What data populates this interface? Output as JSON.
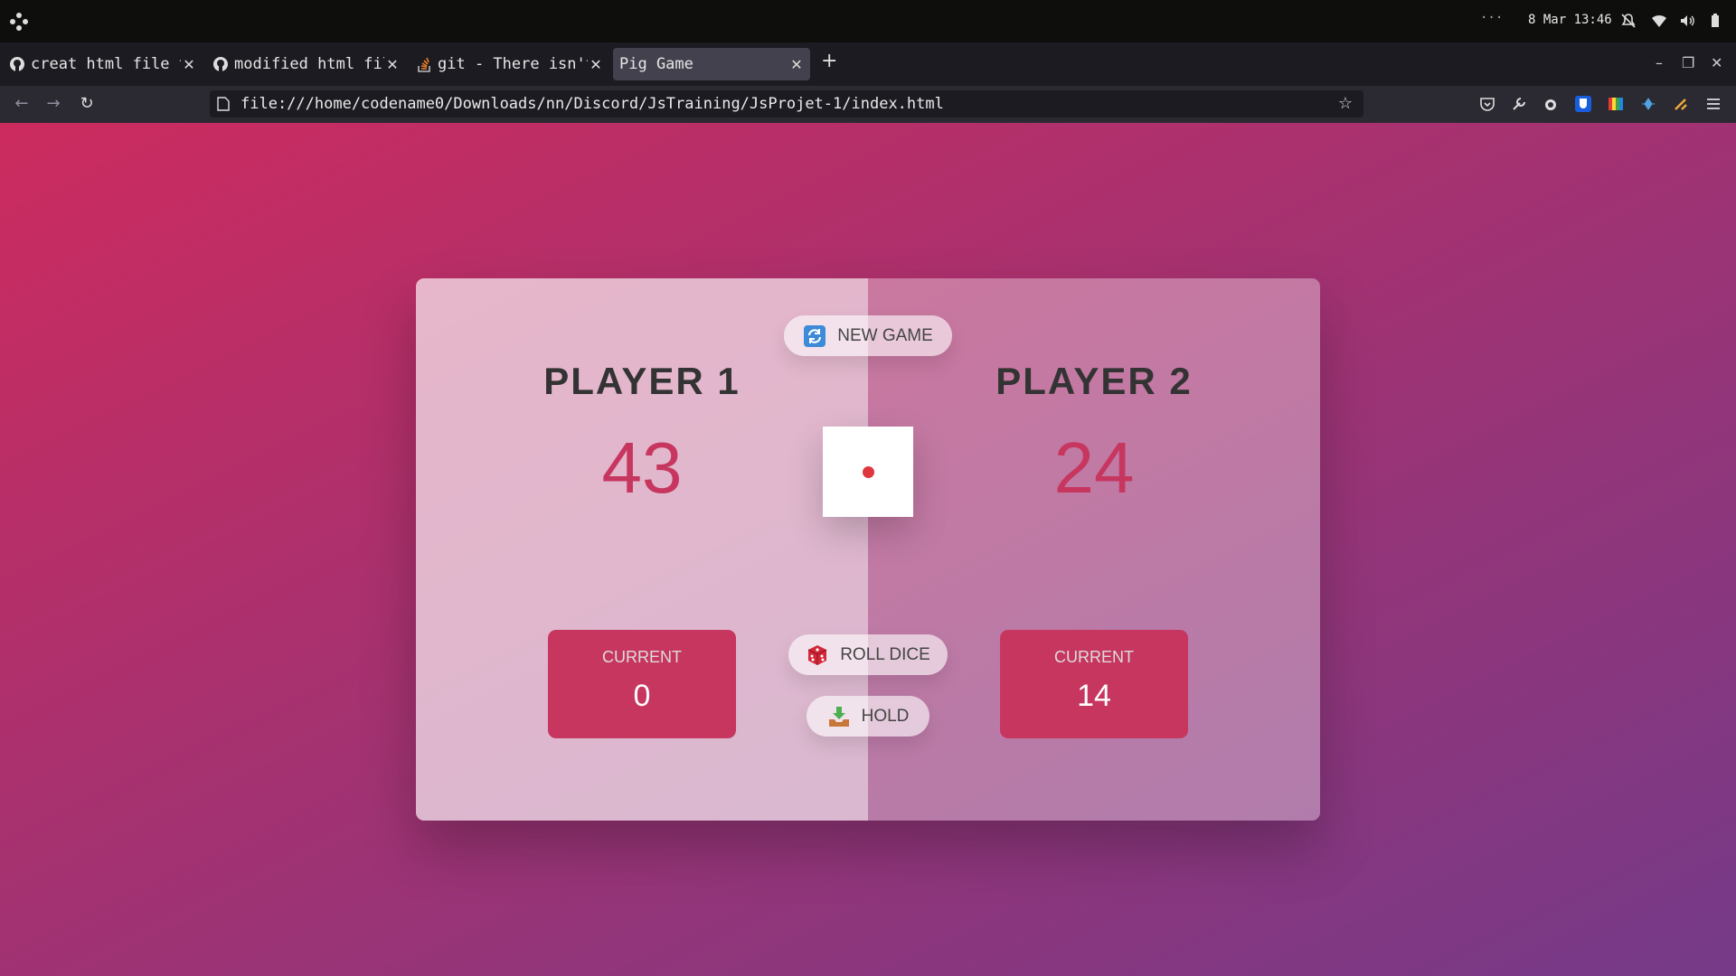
{
  "system_bar": {
    "overflow": "···",
    "clock": "8 Mar 13:46",
    "icons": [
      "apps-logo-icon",
      "notifications-off-icon",
      "wifi-icon",
      "volume-icon",
      "battery-icon"
    ]
  },
  "browser": {
    "tabs": [
      {
        "title": "creat html file t",
        "icon": "github-icon",
        "active": false
      },
      {
        "title": "modified html fil",
        "icon": "github-icon",
        "active": false
      },
      {
        "title": "git - There isn't",
        "icon": "stackoverflow-icon",
        "active": false
      },
      {
        "title": "Pig Game",
        "icon": "",
        "active": true
      }
    ],
    "new_tab": "+",
    "url": "file:///home/codename0/Downloads/nn/Discord/JsTraining/JsProjet-1/index.html",
    "extensions": [
      "pocket-icon",
      "devtools-wrench-icon",
      "extension-icon",
      "bitwarden-icon",
      "colorzilla-icon",
      "extension-icon",
      "extension-icon",
      "menu-icon"
    ]
  },
  "game": {
    "players": [
      {
        "name": "Player 1",
        "score": "43",
        "current_label": "Current",
        "current_score": "0",
        "active": true
      },
      {
        "name": "Player 2",
        "score": "24",
        "current_label": "Current",
        "current_score": "14",
        "active": false
      }
    ],
    "buttons": {
      "new_game": "New game",
      "roll_dice": "Roll dice",
      "hold": "Hold"
    },
    "dice_value": 1,
    "colors": {
      "accent": "#c7365f",
      "gradient_start": "#cc2b5e",
      "gradient_end": "#753a88"
    }
  }
}
